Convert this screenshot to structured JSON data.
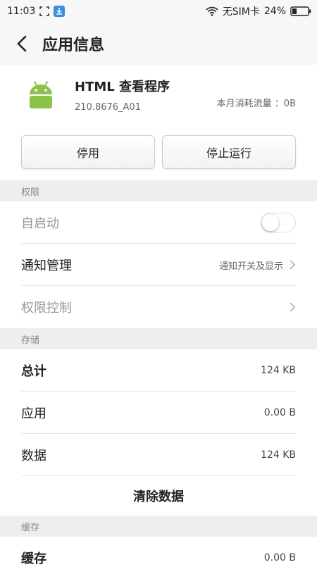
{
  "status": {
    "time": "11:03",
    "carrier": "无SIM卡",
    "battery": "24%"
  },
  "header": {
    "title": "应用信息"
  },
  "app": {
    "name": "HTML  查看程序",
    "version": "210.8676_A01",
    "traffic": "本月消耗流量 ：0B"
  },
  "actions": {
    "disable": "停用",
    "force_stop": "停止运行"
  },
  "sections": {
    "permissions": "权限",
    "storage": "存储",
    "cache": "缓存"
  },
  "permissions": {
    "autostart": "自启动",
    "notification": "通知管理",
    "notification_value": "通知开关及显示",
    "permission_control": "权限控制"
  },
  "storage": {
    "total_label": "总计",
    "total_value": "124 KB",
    "app_label": "应用",
    "app_value": "0.00 B",
    "data_label": "数据",
    "data_value": "124 KB",
    "clear_data": "清除数据"
  },
  "cache": {
    "label": "缓存",
    "value": "0.00 B"
  },
  "colors": {
    "android_green": "#8bc34a",
    "section_bg": "#eeeeee"
  }
}
